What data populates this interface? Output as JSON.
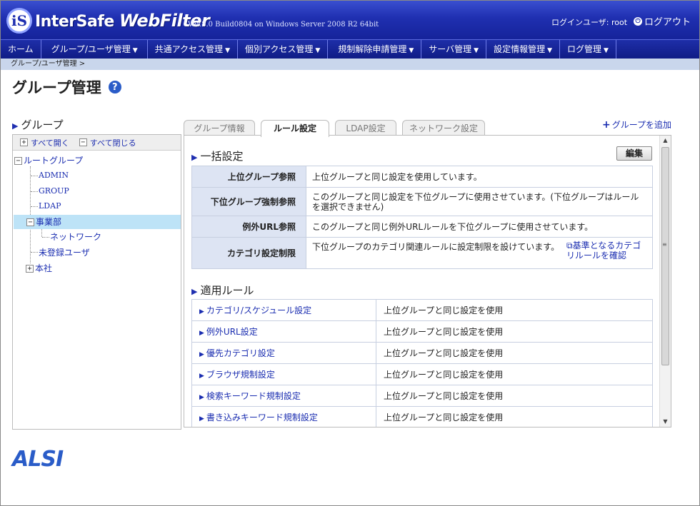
{
  "header": {
    "logo_mark": "iS",
    "logo_text_a": "InterSafe ",
    "logo_text_b": "WebFilter",
    "version": "Ver.8.0 Build0804 on Windows Server 2008 R2 64bit",
    "login_user": "ログインユーザ: root",
    "logout": "ログアウト"
  },
  "nav": [
    {
      "label": "ホーム",
      "caret": ""
    },
    {
      "label": "グループ/ユーザ管理",
      "caret": "▼"
    },
    {
      "label": "共通アクセス管理",
      "caret": "▼"
    },
    {
      "label": "個別アクセス管理",
      "caret": "▼"
    },
    {
      "label": "規制解除申請管理",
      "caret": "▼"
    },
    {
      "label": "サーバ管理",
      "caret": "▼"
    },
    {
      "label": "設定情報管理",
      "caret": "▼"
    },
    {
      "label": "ログ管理",
      "caret": "▼"
    }
  ],
  "breadcrumb": "グループ/ユーザ管理 >",
  "page_title": "グループ管理",
  "help_glyph": "?",
  "left": {
    "heading": "グループ",
    "expand_all": "すべて開く",
    "collapse_all": "すべて閉じる",
    "tree": [
      {
        "label": "ルートグループ",
        "toggle": "−"
      },
      {
        "label": "ADMIN",
        "toggle": ""
      },
      {
        "label": "GROUP",
        "toggle": ""
      },
      {
        "label": "LDAP",
        "toggle": ""
      },
      {
        "label": "事業部",
        "toggle": "−"
      },
      {
        "label": "ネットワーク",
        "toggle": ""
      },
      {
        "label": "未登録ユーザ",
        "toggle": ""
      },
      {
        "label": "本社",
        "toggle": "+"
      }
    ]
  },
  "tabs": [
    "グループ情報",
    "ルール設定",
    "LDAP設定",
    "ネットワーク設定"
  ],
  "add_group": "グループを追加",
  "bulk": {
    "heading": "一括設定",
    "edit": "編集",
    "rows": [
      {
        "label": "上位グループ参照",
        "value": "上位グループと同じ設定を使用しています。"
      },
      {
        "label": "下位グループ強制参照",
        "value": "このグループと同じ設定を下位グループに使用させています。(下位グループはルールを選択できません)"
      },
      {
        "label": "例外URL参照",
        "value": "このグループと同じ例外URLルールを下位グループに使用させています。"
      },
      {
        "label": "カテゴリ設定制限",
        "value": "下位グループのカテゴリ関連ルールに設定制限を設けています。",
        "link": "基準となるカテゴリルールを確認"
      }
    ]
  },
  "rules": {
    "heading": "適用ルール",
    "rows": [
      {
        "label": "カテゴリ/スケジュール設定",
        "value": "上位グループと同じ設定を使用"
      },
      {
        "label": "例外URL設定",
        "value": "上位グループと同じ設定を使用"
      },
      {
        "label": "優先カテゴリ設定",
        "value": "上位グループと同じ設定を使用"
      },
      {
        "label": "ブラウザ規制設定",
        "value": "上位グループと同じ設定を使用"
      },
      {
        "label": "検索キーワード規制設定",
        "value": "上位グループと同じ設定を使用"
      },
      {
        "label": "書き込みキーワード規制設定",
        "value": "上位グループと同じ設定を使用"
      }
    ]
  },
  "footer_logo": "ALSI"
}
